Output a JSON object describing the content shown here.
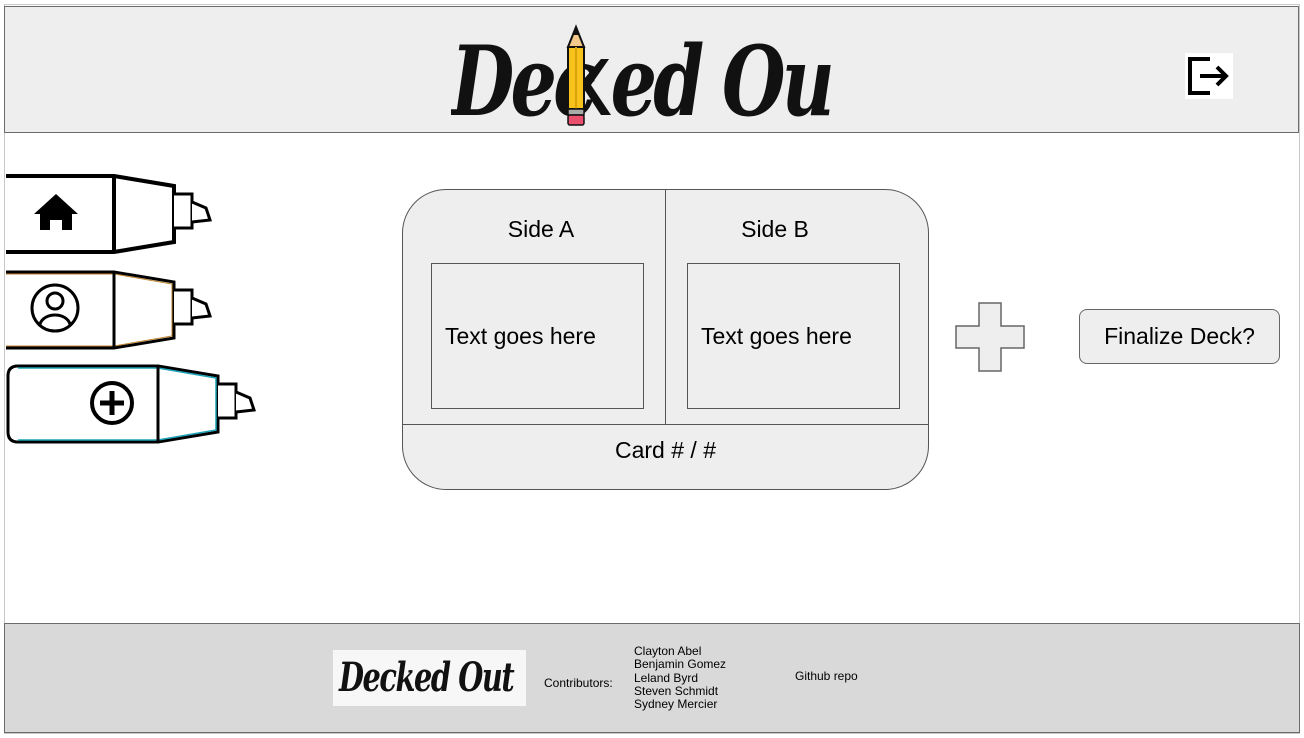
{
  "header": {
    "logo_text_left": "Dec",
    "logo_text_right": "ed Out"
  },
  "nav": {
    "items": [
      {
        "name": "home",
        "icon": "home-icon",
        "color": "#000000"
      },
      {
        "name": "profile",
        "icon": "user-circle-icon",
        "color": "#c0822e"
      },
      {
        "name": "create-deck",
        "icon": "plus-circle-icon",
        "color": "#1aa3b8"
      }
    ]
  },
  "card": {
    "side_a_label": "Side A",
    "side_b_label": "Side B",
    "side_a_text": "Text goes here",
    "side_b_text": "Text goes here",
    "counter": "Card # / #"
  },
  "actions": {
    "finalize_label": "Finalize Deck?"
  },
  "footer": {
    "logo_text": "Decked Out",
    "contributors_label": "Contributors:",
    "contributors": [
      "Clayton Abel",
      "Benjamin Gomez",
      "Leland Byrd",
      "Steven Schmidt",
      "Sydney Mercier"
    ],
    "github_label": "Github repo"
  }
}
